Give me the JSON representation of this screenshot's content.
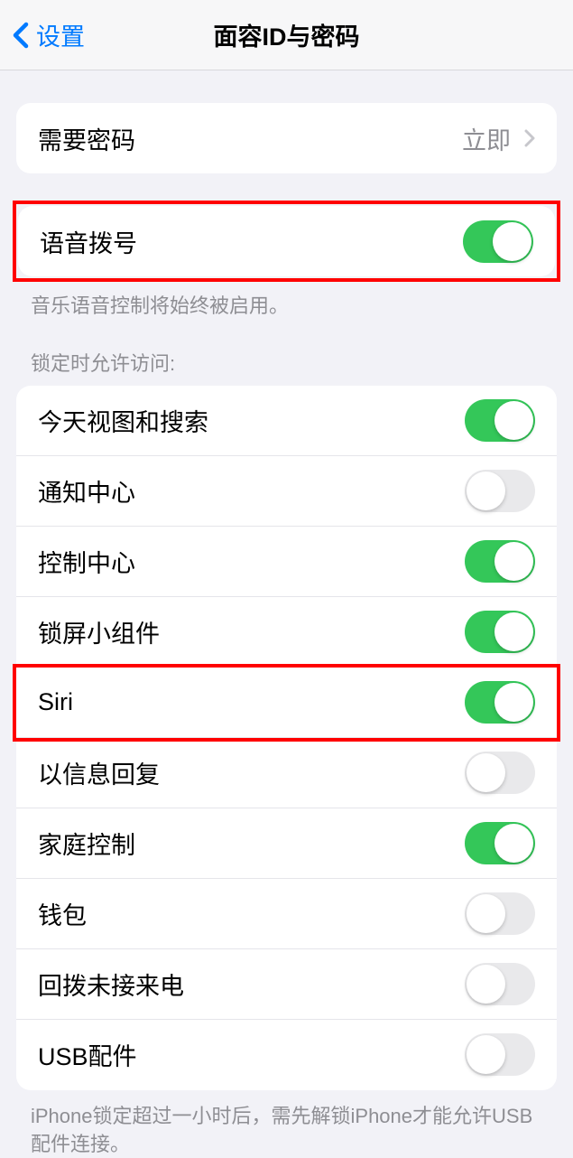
{
  "header": {
    "back_label": "设置",
    "title": "面容ID与密码"
  },
  "require_passcode": {
    "label": "需要密码",
    "value": "立即"
  },
  "voice_dial": {
    "label": "语音拨号",
    "footer": "音乐语音控制将始终被启用。",
    "on": true
  },
  "lock_section_header": "锁定时允许访问:",
  "lock_items": [
    {
      "label": "今天视图和搜索",
      "on": true
    },
    {
      "label": "通知中心",
      "on": false
    },
    {
      "label": "控制中心",
      "on": true
    },
    {
      "label": "锁屏小组件",
      "on": true
    },
    {
      "label": "Siri",
      "on": true
    },
    {
      "label": "以信息回复",
      "on": false
    },
    {
      "label": "家庭控制",
      "on": true
    },
    {
      "label": "钱包",
      "on": false
    },
    {
      "label": "回拨未接来电",
      "on": false
    },
    {
      "label": "USB配件",
      "on": false
    }
  ],
  "usb_footer": "iPhone锁定超过一小时后，需先解锁iPhone才能允许USB配件连接。"
}
